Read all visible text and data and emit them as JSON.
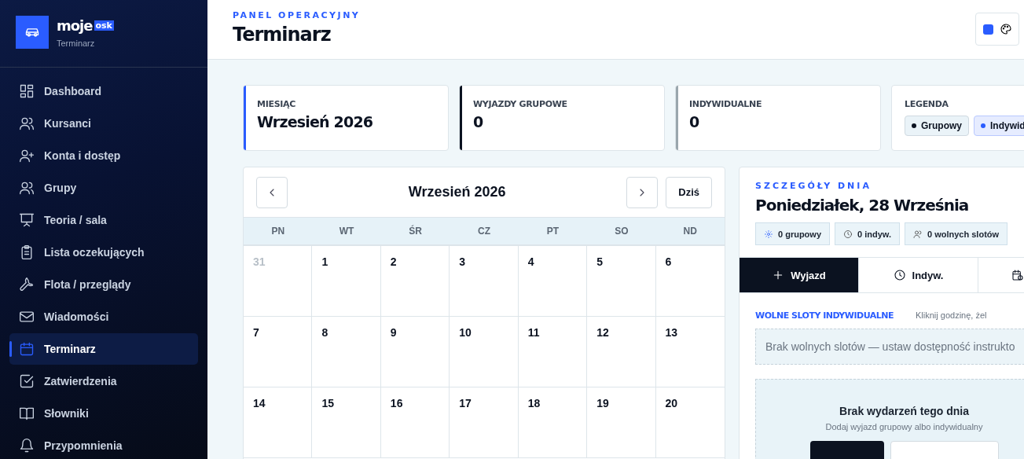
{
  "brand": {
    "name": "moje",
    "badge": "osk",
    "subtitle": "Terminarz"
  },
  "sidebar": {
    "items": [
      {
        "label": "Dashboard",
        "selected": false
      },
      {
        "label": "Kursanci",
        "selected": false
      },
      {
        "label": "Konta i dostęp",
        "selected": false
      },
      {
        "label": "Grupy",
        "selected": false
      },
      {
        "label": "Teoria / sala",
        "selected": false
      },
      {
        "label": "Lista oczekujących",
        "selected": false
      },
      {
        "label": "Flota / przeglądy",
        "selected": false
      },
      {
        "label": "Wiadomości",
        "selected": false
      },
      {
        "label": "Terminarz",
        "selected": true
      },
      {
        "label": "Zatwierdzenia",
        "selected": false
      },
      {
        "label": "Słowniki",
        "selected": false
      },
      {
        "label": "Przypomnienia",
        "selected": false
      }
    ]
  },
  "header": {
    "eyebrow": "PANEL OPERACYJNY",
    "title": "Terminarz"
  },
  "stats": [
    {
      "label": "MIESIĄC",
      "value": "Wrzesień 2026",
      "color": "#2a5cff"
    },
    {
      "label": "WYJAZDY GRUPOWE",
      "value": "0",
      "color": "#0b1220"
    },
    {
      "label": "INDYWIDUALNE",
      "value": "0",
      "color": "#9aa6ad"
    }
  ],
  "legend": {
    "label": "LEGENDA",
    "items": [
      {
        "label": "Grupowy",
        "color": "#0b1220"
      },
      {
        "label": "Indywid",
        "color": "#2a5cff"
      }
    ]
  },
  "calendar": {
    "title": "Wrzesień 2026",
    "today_button": "Dziś",
    "weekdays": [
      "PN",
      "WT",
      "ŚR",
      "CZ",
      "PT",
      "SO",
      "ND"
    ],
    "weeks": [
      [
        {
          "day": "31",
          "muted": true
        },
        {
          "day": "1",
          "muted": false
        },
        {
          "day": "2",
          "muted": false
        },
        {
          "day": "3",
          "muted": false
        },
        {
          "day": "4",
          "muted": false
        },
        {
          "day": "5",
          "muted": false
        },
        {
          "day": "6",
          "muted": false
        }
      ],
      [
        {
          "day": "7",
          "muted": false
        },
        {
          "day": "8",
          "muted": false
        },
        {
          "day": "9",
          "muted": false
        },
        {
          "day": "10",
          "muted": false
        },
        {
          "day": "11",
          "muted": false
        },
        {
          "day": "12",
          "muted": false
        },
        {
          "day": "13",
          "muted": false
        }
      ],
      [
        {
          "day": "14",
          "muted": false
        },
        {
          "day": "15",
          "muted": false
        },
        {
          "day": "16",
          "muted": false
        },
        {
          "day": "17",
          "muted": false
        },
        {
          "day": "18",
          "muted": false
        },
        {
          "day": "19",
          "muted": false
        },
        {
          "day": "20",
          "muted": false
        }
      ]
    ]
  },
  "day_panel": {
    "eyebrow": "SZCZEGÓŁY DNIA",
    "title": "Poniedziałek, 28 Września",
    "chips": [
      "0 grupowy",
      "0 indyw.",
      "0 wolnych slotów"
    ],
    "tabs": [
      {
        "label": "Wyjazd",
        "selected": true
      },
      {
        "label": "Indyw.",
        "selected": false
      },
      {
        "selected": false
      }
    ],
    "slots": {
      "title": "WOLNE SLOTY INDYWIDUALNE",
      "hint": "Kliknij godzinę, żel",
      "empty": "Brak wolnych slotów — ustaw dostępność instrukto"
    },
    "empty_state": {
      "title": "Brak wydarzeń tego dnia",
      "subtitle": "Dodaj wyjazd grupowy albo indywidualny"
    }
  }
}
